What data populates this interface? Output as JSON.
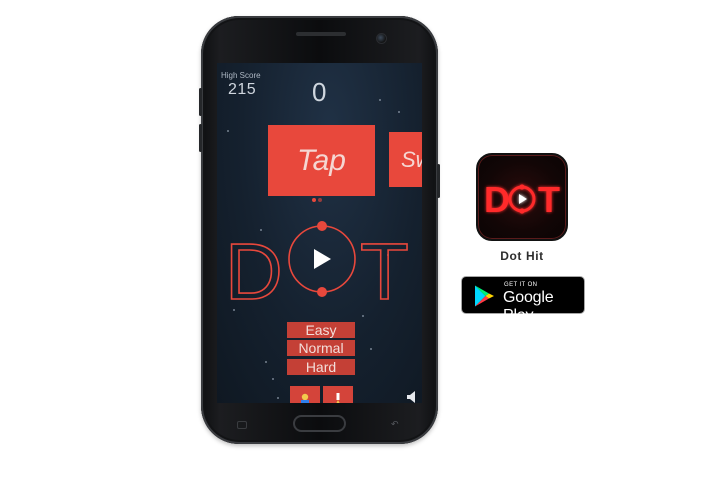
{
  "game": {
    "high_score_label": "High Score",
    "high_score_value": "215",
    "current_score": "0",
    "tutorial_cards": {
      "tap": "Tap",
      "swipe": "Sw"
    },
    "logo_text_left": "D",
    "logo_text_right": "T",
    "difficulty": {
      "easy": "Easy",
      "normal": "Normal",
      "hard": "Hard"
    }
  },
  "store": {
    "app_icon_text_left": "D",
    "app_icon_text_right": "T",
    "app_name": "Dot Hit",
    "badge_small": "GET IT ON",
    "badge_big": "Google Play"
  },
  "colors": {
    "accent": "#e8483c",
    "screen_bg": "#172332",
    "icon_glow": "#ff2a2a"
  },
  "icons": [
    "play-icon",
    "achievements-icon",
    "leaderboard-icon",
    "sound-icon",
    "google-play-icon"
  ]
}
